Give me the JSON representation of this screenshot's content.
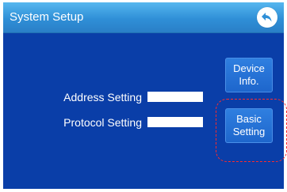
{
  "header": {
    "title": "System Setup",
    "back_icon": "back-arrow-icon"
  },
  "main": {
    "address_label": "Address Setting",
    "address_value": "",
    "protocol_label": "Protocol Setting",
    "protocol_value": ""
  },
  "side_buttons": {
    "device_info_line1": "Device",
    "device_info_line2": "Info.",
    "basic_setting_line1": "Basic",
    "basic_setting_line2": "Setting"
  },
  "colors": {
    "title_bar": "#2f8fd7",
    "main_background": "#0a3ea8",
    "button": "#1e66cc",
    "highlight": "#ff2b2b"
  }
}
